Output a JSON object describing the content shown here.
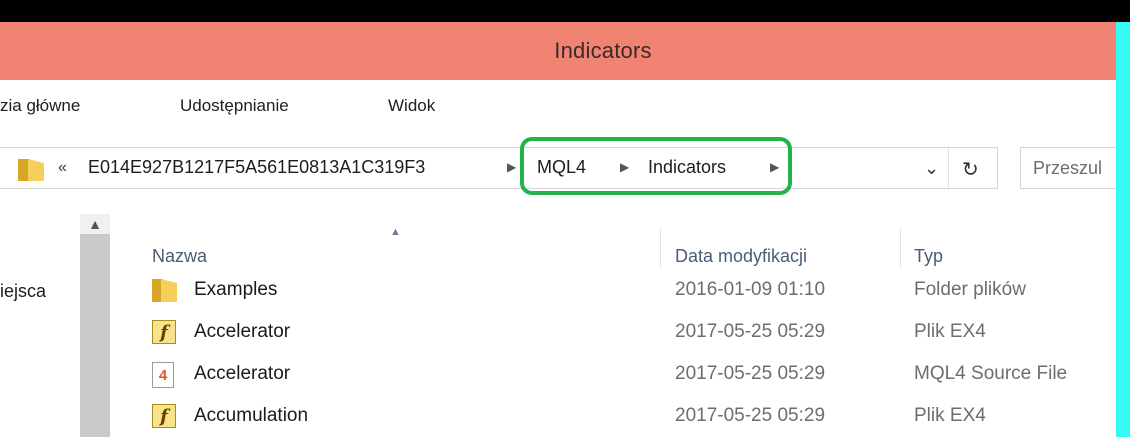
{
  "window": {
    "title": "Indicators"
  },
  "ribbon": {
    "tabs": [
      "zia główne",
      "Udostępnianie",
      "Widok"
    ]
  },
  "address": {
    "back_glyph": "«",
    "crumbs": [
      "E014E927B1217F5A561E0813A1C319F3",
      "MQL4",
      "Indicators"
    ],
    "dropdown_glyph": "⌄",
    "refresh_glyph": "↻"
  },
  "search": {
    "placeholder": "Przeszul"
  },
  "nav": {
    "visible_label": "iejsca"
  },
  "columns": {
    "name": "Nazwa",
    "date": "Data modyfikacji",
    "type": "Typ"
  },
  "files": [
    {
      "icon": "folder-icon",
      "name": "Examples",
      "date": "2016-01-09 01:10",
      "type": "Folder plików"
    },
    {
      "icon": "ex4-file-icon",
      "name": "Accelerator",
      "date": "2017-05-25 05:29",
      "type": "Plik EX4"
    },
    {
      "icon": "mq4-source-file-icon",
      "name": "Accelerator",
      "date": "2017-05-25 05:29",
      "type": "MQL4 Source File"
    },
    {
      "icon": "ex4-file-icon",
      "name": "Accumulation",
      "date": "2017-05-25 05:29",
      "type": "Plik EX4"
    }
  ],
  "icon_glyphs": {
    "ex4": "f",
    "mq4": "4"
  },
  "colors": {
    "titlebar": "#f08372",
    "highlight": "#24b24a",
    "frame": "#35fbf2"
  }
}
